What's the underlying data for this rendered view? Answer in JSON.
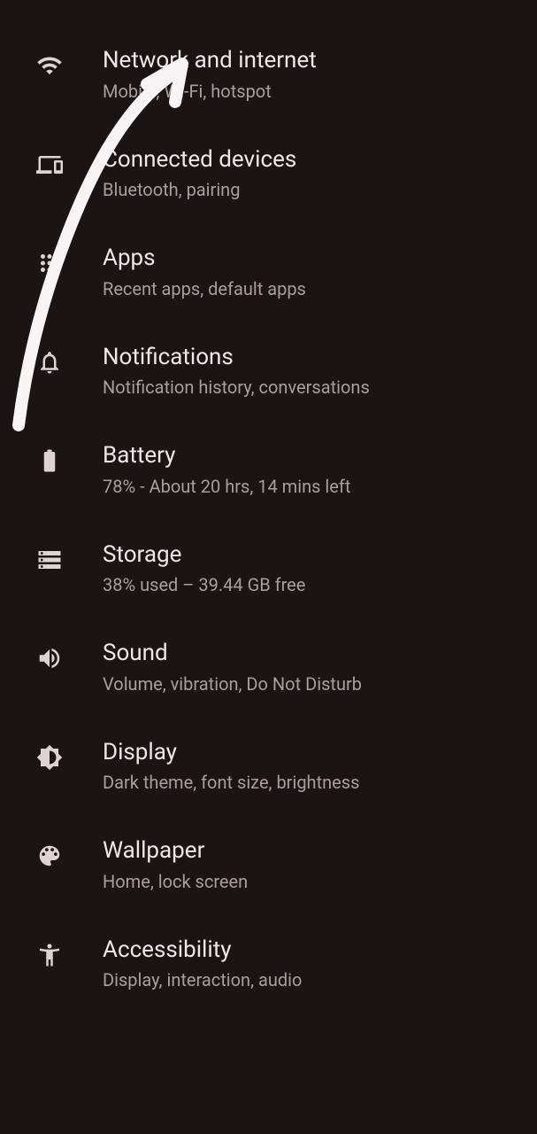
{
  "settings": {
    "items": [
      {
        "id": "network",
        "title": "Network and internet",
        "subtitle": "Mobile, Wi-Fi, hotspot",
        "icon": "wifi-icon"
      },
      {
        "id": "connected",
        "title": "Connected devices",
        "subtitle": "Bluetooth, pairing",
        "icon": "devices-icon"
      },
      {
        "id": "apps",
        "title": "Apps",
        "subtitle": "Recent apps, default apps",
        "icon": "apps-icon"
      },
      {
        "id": "notifications",
        "title": "Notifications",
        "subtitle": "Notification history, conversations",
        "icon": "bell-icon"
      },
      {
        "id": "battery",
        "title": "Battery",
        "subtitle": "78% - About 20 hrs, 14 mins left",
        "icon": "battery-icon"
      },
      {
        "id": "storage",
        "title": "Storage",
        "subtitle": "38% used – 39.44 GB free",
        "icon": "storage-icon"
      },
      {
        "id": "sound",
        "title": "Sound",
        "subtitle": "Volume, vibration, Do Not Disturb",
        "icon": "sound-icon"
      },
      {
        "id": "display",
        "title": "Display",
        "subtitle": "Dark theme, font size, brightness",
        "icon": "brightness-icon"
      },
      {
        "id": "wallpaper",
        "title": "Wallpaper",
        "subtitle": "Home, lock screen",
        "icon": "palette-icon"
      },
      {
        "id": "accessibility",
        "title": "Accessibility",
        "subtitle": "Display, interaction, audio",
        "icon": "accessibility-icon"
      }
    ]
  },
  "annotation": {
    "type": "hand-drawn-arrow",
    "points_to": "network",
    "color": "#f8f4f5"
  }
}
